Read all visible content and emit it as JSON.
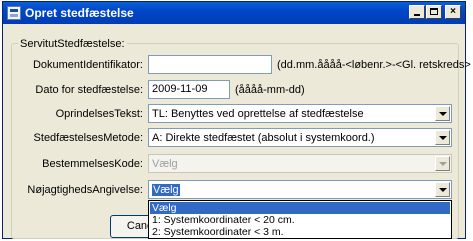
{
  "window": {
    "title": "Opret stedfæstelse"
  },
  "group": {
    "legend": "ServitutStedfæstelse:"
  },
  "fields": {
    "dokument_id": {
      "label": "DokumentIdentifikator:",
      "value": "",
      "hint": "(dd.mm.åååå-<løbenr.>-<Gl. retskreds>"
    },
    "dato": {
      "label": "Dato for stedfæstelse:",
      "value": "2009-11-09",
      "hint": "(åååå-mm-dd)"
    },
    "oprindelse": {
      "label": "OprindelsesTekst:",
      "value": "TL: Benyttes ved oprettelse af stedfæstelse"
    },
    "metode": {
      "label": "StedfæstelsesMetode:",
      "value": "A: Direkte stedfæstet (absolut i systemkoord.)"
    },
    "bestemmelse": {
      "label": "BestemmelsesKode:",
      "value": "Vælg"
    },
    "noejagtighed": {
      "label": "NøjagtighedsAngivelse:",
      "value": "Vælg",
      "options": [
        "Vælg",
        "1: Systemkoordinater < 20 cm.",
        "2: Systemkoordinater < 3 m."
      ]
    }
  },
  "buttons": {
    "cancel": "Cancel"
  }
}
